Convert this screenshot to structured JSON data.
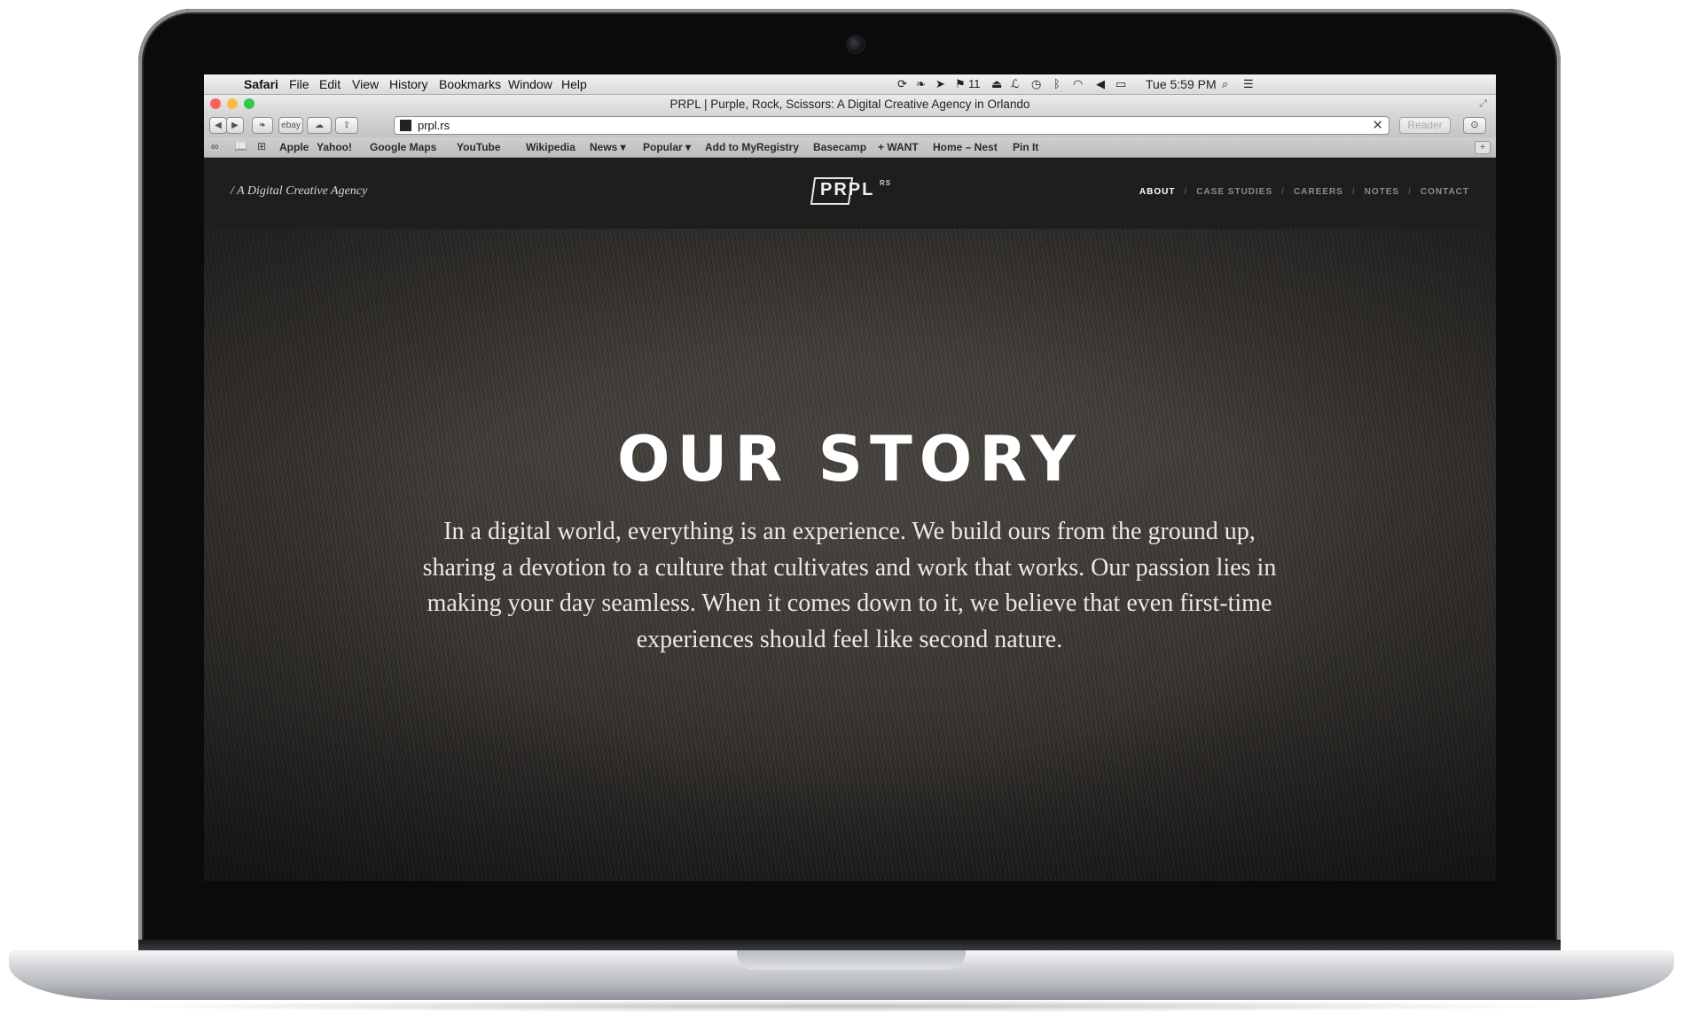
{
  "menubar": {
    "app": "Safari",
    "items": [
      "File",
      "Edit",
      "View",
      "History",
      "Bookmarks",
      "Window",
      "Help"
    ],
    "status": {
      "notifications": "11",
      "clock": "Tue 5:59 PM"
    }
  },
  "window": {
    "title": "PRPL | Purple, Rock, Scissors: A Digital Creative Agency in Orlando"
  },
  "toolbar": {
    "ebay_label": "ebay",
    "url": "prpl.rs",
    "reader_label": "Reader"
  },
  "bookmarks": [
    "Apple",
    "Yahoo!",
    "Google Maps",
    "YouTube",
    "Wikipedia",
    "News ▾",
    "Popular ▾",
    "Add to MyRegistry",
    "Basecamp",
    "+ WANT",
    "Home – Nest",
    "Pin It"
  ],
  "site": {
    "tagline": "/ A Digital Creative Agency",
    "logo": "PRPL",
    "logo_sup": "RS",
    "nav": [
      "ABOUT",
      "CASE STUDIES",
      "CAREERS",
      "NOTES",
      "CONTACT"
    ],
    "hero_title": "OUR STORY",
    "hero_body": "In a digital world, everything is an experience. We build ours from the ground up, sharing a devotion to a culture that cultivates and work that works. Our passion lies in making your day seamless. When it comes down to it, we believe that even first-time experiences should feel like second nature."
  },
  "colors": {
    "close": "#fc605c",
    "minimize": "#fdbc40",
    "zoom": "#34c84a",
    "header_bg": "#1e1e1f"
  }
}
